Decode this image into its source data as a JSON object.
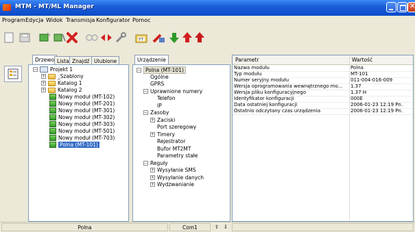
{
  "window": {
    "title": "MTM - MT/ML Manager"
  },
  "menu": [
    "Program",
    "Edycja",
    "Widok",
    "Transmisja",
    "Konfigurator",
    "Pomoc"
  ],
  "toolbar": {
    "buttons": [
      "new-document",
      "save",
      "module-add",
      "module-remove",
      "delete",
      "link",
      "unlink",
      "tool",
      "yt-folder",
      "send",
      "download",
      "upload",
      "upload-alt"
    ],
    "colors": {
      "delete": "#d22020",
      "download": "#2e9a28",
      "upload": "#d22020",
      "link": "#d22020"
    },
    "yt_label": "YT"
  },
  "left_tabs": [
    "Drzewo",
    "Lista",
    "Znajdź",
    "Ulubione"
  ],
  "project_tree": [
    {
      "label": "Projekt 1",
      "type": "project",
      "expander": "−"
    },
    {
      "label": "_Szablony",
      "type": "folder",
      "expander": "+"
    },
    {
      "label": "Katalog 1",
      "type": "folder",
      "expander": "+"
    },
    {
      "label": "Katalog 2",
      "type": "folder",
      "expander": "+"
    },
    {
      "label": "Nowy moduł  (MT-102)",
      "type": "module"
    },
    {
      "label": "Nowy moduł  (MT-201)",
      "type": "module"
    },
    {
      "label": "Nowy moduł  (MT-301)",
      "type": "module"
    },
    {
      "label": "Nowy moduł  (MT-302)",
      "type": "module"
    },
    {
      "label": "Nowy moduł  (MT-303)",
      "type": "module"
    },
    {
      "label": "Nowy moduł  (MT-501)",
      "type": "module"
    },
    {
      "label": "Nowy moduł  (MT-703)",
      "type": "module"
    },
    {
      "label": "Polna (MT-101)",
      "type": "module",
      "selected": true
    }
  ],
  "device_tab": "Urządzenie",
  "device_tree": [
    {
      "label": "Polna (MT-101)",
      "expander": "−"
    },
    {
      "label": "Ogólne"
    },
    {
      "label": "GPRS"
    },
    {
      "label": "Uprawnione numery",
      "expander": "−"
    },
    {
      "label": "Telefon"
    },
    {
      "label": "IP"
    },
    {
      "label": "Zasoby",
      "expander": "−"
    },
    {
      "label": "Zaciski",
      "expander": "+"
    },
    {
      "label": "Port szeregowy"
    },
    {
      "label": "Timery",
      "expander": "+"
    },
    {
      "label": "Rejestrator"
    },
    {
      "label": "Bufor MT2MT"
    },
    {
      "label": "Parametry stałe"
    },
    {
      "label": "Reguły",
      "expander": "−"
    },
    {
      "label": "Wysyłanie SMS",
      "expander": "+"
    },
    {
      "label": "Wysyłanie danych",
      "expander": "+"
    },
    {
      "label": "Wydzwanianie",
      "expander": "+"
    }
  ],
  "grid": {
    "headers": [
      "Parametr",
      "Wartość"
    ],
    "rows": [
      [
        "Nazwa modułu",
        "Polna"
      ],
      [
        "Typ modułu",
        "MT-101"
      ],
      [
        "Numer seryjny modułu",
        "011-004-016-009"
      ],
      [
        "Wersja oprogramowania wewnętrznego mo...",
        "1.37"
      ],
      [
        "Wersja pliku konfiguracyjnego",
        "1.37 H"
      ],
      [
        "Identyfikator konfiguracji",
        "000E"
      ],
      [
        "Data ostatniej konfiguracji",
        "2006-01-23 12:19 Pn."
      ],
      [
        "Ostatnio odczytany czas urządzenia",
        "2006-01-23 12:19 Pn."
      ]
    ]
  },
  "status": {
    "module": "Polna",
    "port": "Com1",
    "up": "⇧",
    "down": "⇩"
  }
}
